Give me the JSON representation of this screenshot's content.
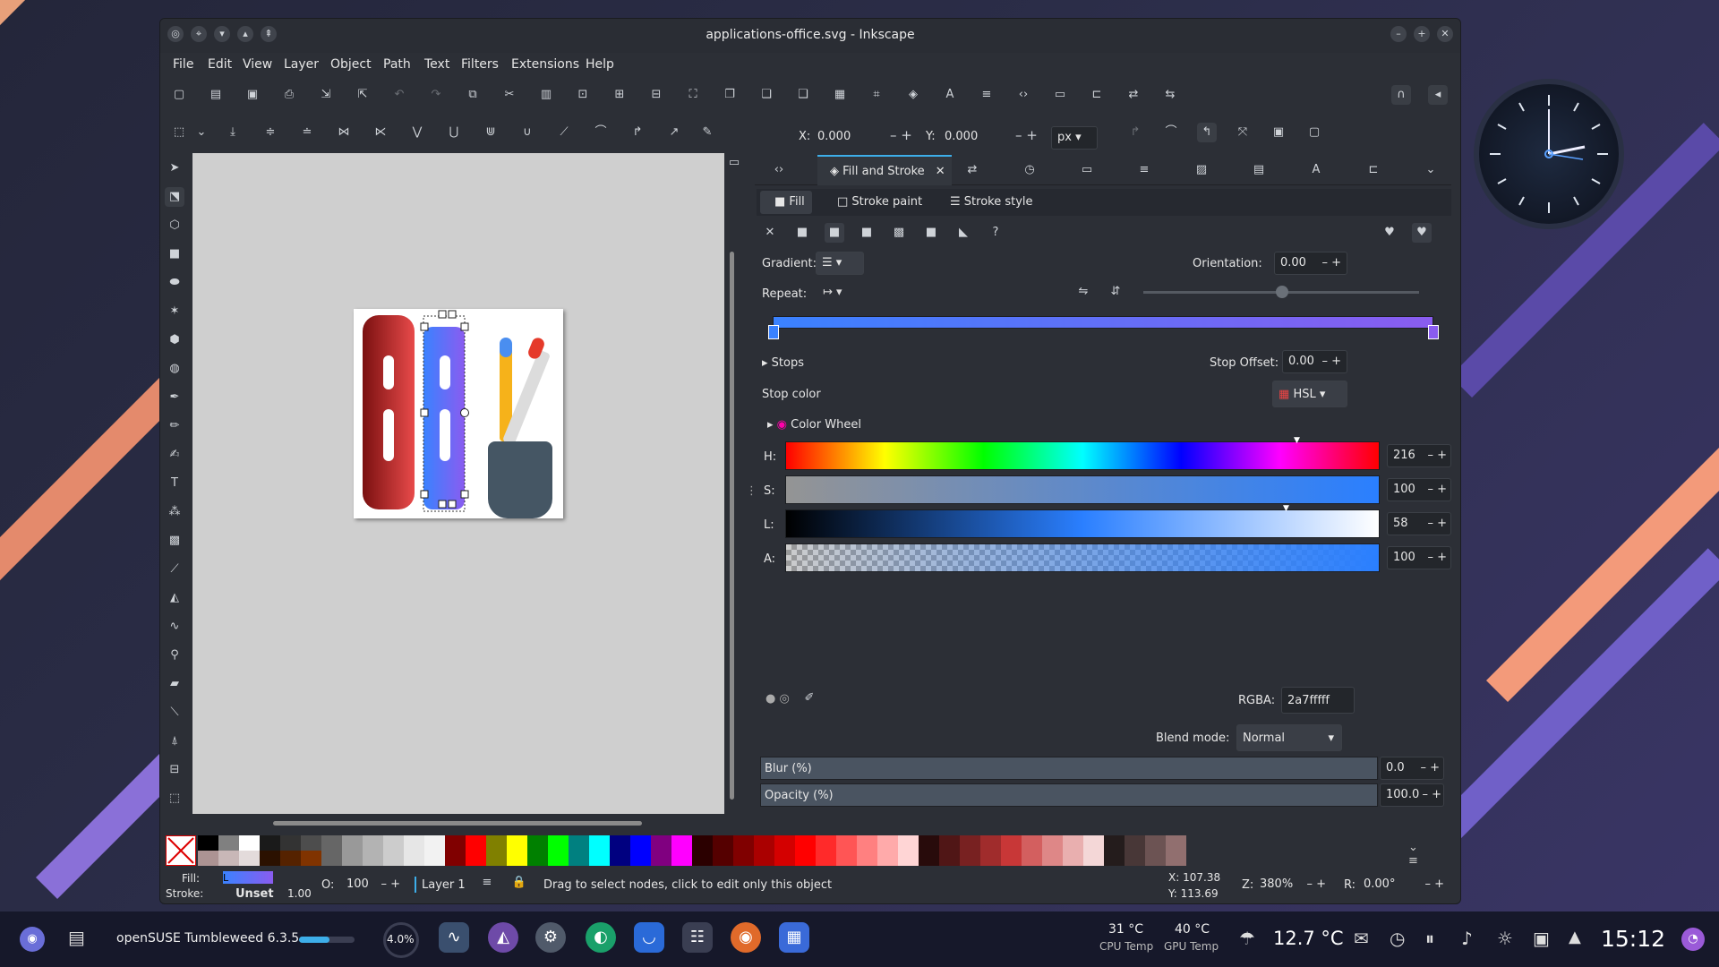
{
  "window": {
    "title": "applications-office.svg - Inkscape"
  },
  "menu": [
    "File",
    "Edit",
    "View",
    "Layer",
    "Object",
    "Path",
    "Text",
    "Filters",
    "Extensions",
    "Help"
  ],
  "node_toolbar": {
    "x_label": "X:",
    "x_value": "0.000",
    "y_label": "Y:",
    "y_value": "0.000",
    "unit": "px"
  },
  "panel": {
    "tab_label": "Fill and Stroke",
    "subtabs": [
      "Fill",
      "Stroke paint",
      "Stroke style"
    ],
    "gradient_label": "Gradient:",
    "orientation_label": "Orientation:",
    "orientation_value": "0.00",
    "repeat_label": "Repeat:",
    "stops_label": "Stops",
    "stop_offset_label": "Stop Offset:",
    "stop_offset_value": "0.00",
    "stop_color_label": "Stop color",
    "color_mode": "HSL",
    "color_wheel_label": "Color Wheel",
    "h_label": "H:",
    "h_value": "216",
    "s_label": "S:",
    "s_value": "100",
    "l_label": "L:",
    "l_value": "58",
    "a_label": "A:",
    "a_value": "100",
    "rgba_label": "RGBA:",
    "rgba_value": "2a7fffff",
    "blend_label": "Blend mode:",
    "blend_value": "Normal",
    "blur_label": "Blur (%)",
    "blur_value": "0.0",
    "opacity_label": "Opacity (%)",
    "opacity_value": "100.0",
    "gradient_stop_colors": [
      "#3a82ff",
      "#8a5cf0"
    ]
  },
  "status": {
    "fill_label": "Fill:",
    "fill_value": "L",
    "stroke_label": "Stroke:",
    "stroke_value": "Unset",
    "stroke_width": "1.00",
    "opacity_label": "O:",
    "opacity_value": "100",
    "layer": "Layer 1",
    "message": "Drag to select nodes, click to edit only this object",
    "x_label": "X:",
    "x_value": "107.38",
    "y_label": "Y:",
    "y_value": "113.69",
    "zoom_label": "Z:",
    "zoom_value": "380%",
    "rotation_label": "R:",
    "rotation_value": "0.00°"
  },
  "taskbar": {
    "app_title": "openSUSE Tumbleweed 6.3.5",
    "cpu_usage": "4.0%",
    "cpu_temp": "31 °C",
    "cpu_temp_label": "CPU Temp",
    "gpu_temp": "40 °C",
    "gpu_temp_label": "GPU Temp",
    "weather": "12.7 °C",
    "clock": "15:12"
  },
  "palette": [
    "#000000",
    "#808080",
    "#ffffff",
    "#1a1a1a",
    "#333333",
    "#4d4d4d",
    "#666666",
    "#999999",
    "#b3b3b3",
    "#cccccc",
    "#e6e6e6",
    "#f2f2f2",
    "#800000",
    "#ff0000",
    "#808000",
    "#ffff00",
    "#008000",
    "#00ff00",
    "#008080",
    "#00ffff",
    "#000080",
    "#0000ff",
    "#800080",
    "#ff00ff",
    "#2b0000",
    "#550000",
    "#800000",
    "#aa0000",
    "#d40000",
    "#ff0000",
    "#ff2a2a",
    "#ff5555",
    "#ff8080",
    "#ffaaaa",
    "#ffd5d5",
    "#280b0b",
    "#501616",
    "#782121",
    "#a02c2c",
    "#c83737",
    "#d35f5f",
    "#de8787",
    "#e9afaf",
    "#f4d7d7",
    "#241c1c",
    "#483737",
    "#6c5353",
    "#916f6f",
    "#ac9393",
    "#c8b7b7",
    "#e3dbdb",
    "#2b1100",
    "#552200",
    "#803300"
  ]
}
